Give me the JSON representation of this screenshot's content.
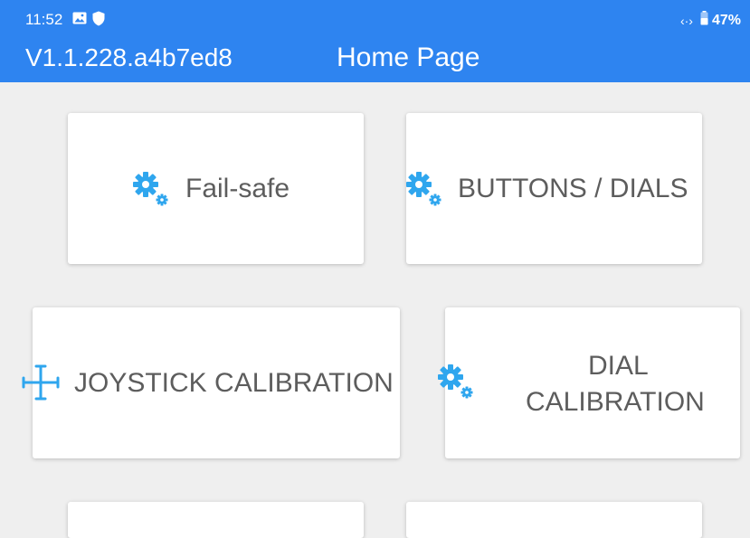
{
  "status_bar": {
    "time": "11:52",
    "icons": [
      "image-icon",
      "shield-icon",
      "data-sync-icon",
      "battery-icon"
    ],
    "battery_percent": "47%",
    "data_indicator": "‹·›"
  },
  "header": {
    "version": "V1.1.228.a4b7ed8",
    "title": "Home Page",
    "background_color": "#2e84f0"
  },
  "cards": {
    "fail_safe": {
      "label": "Fail-safe",
      "icon": "gears-icon"
    },
    "buttons_dials": {
      "label": "BUTTONS / DIALS",
      "icon": "gears-icon"
    },
    "joystick_calibration": {
      "label": "JOYSTICK CALIBRATION",
      "icon": "crosshair-icon"
    },
    "dial_calibration": {
      "label_line1": "DIAL",
      "label_line2": "CALIBRATION",
      "icon": "gears-icon"
    }
  },
  "colors": {
    "icon_accent": "#2fa6ee",
    "card_text": "#5d5d5d",
    "page_background": "#efefef"
  }
}
